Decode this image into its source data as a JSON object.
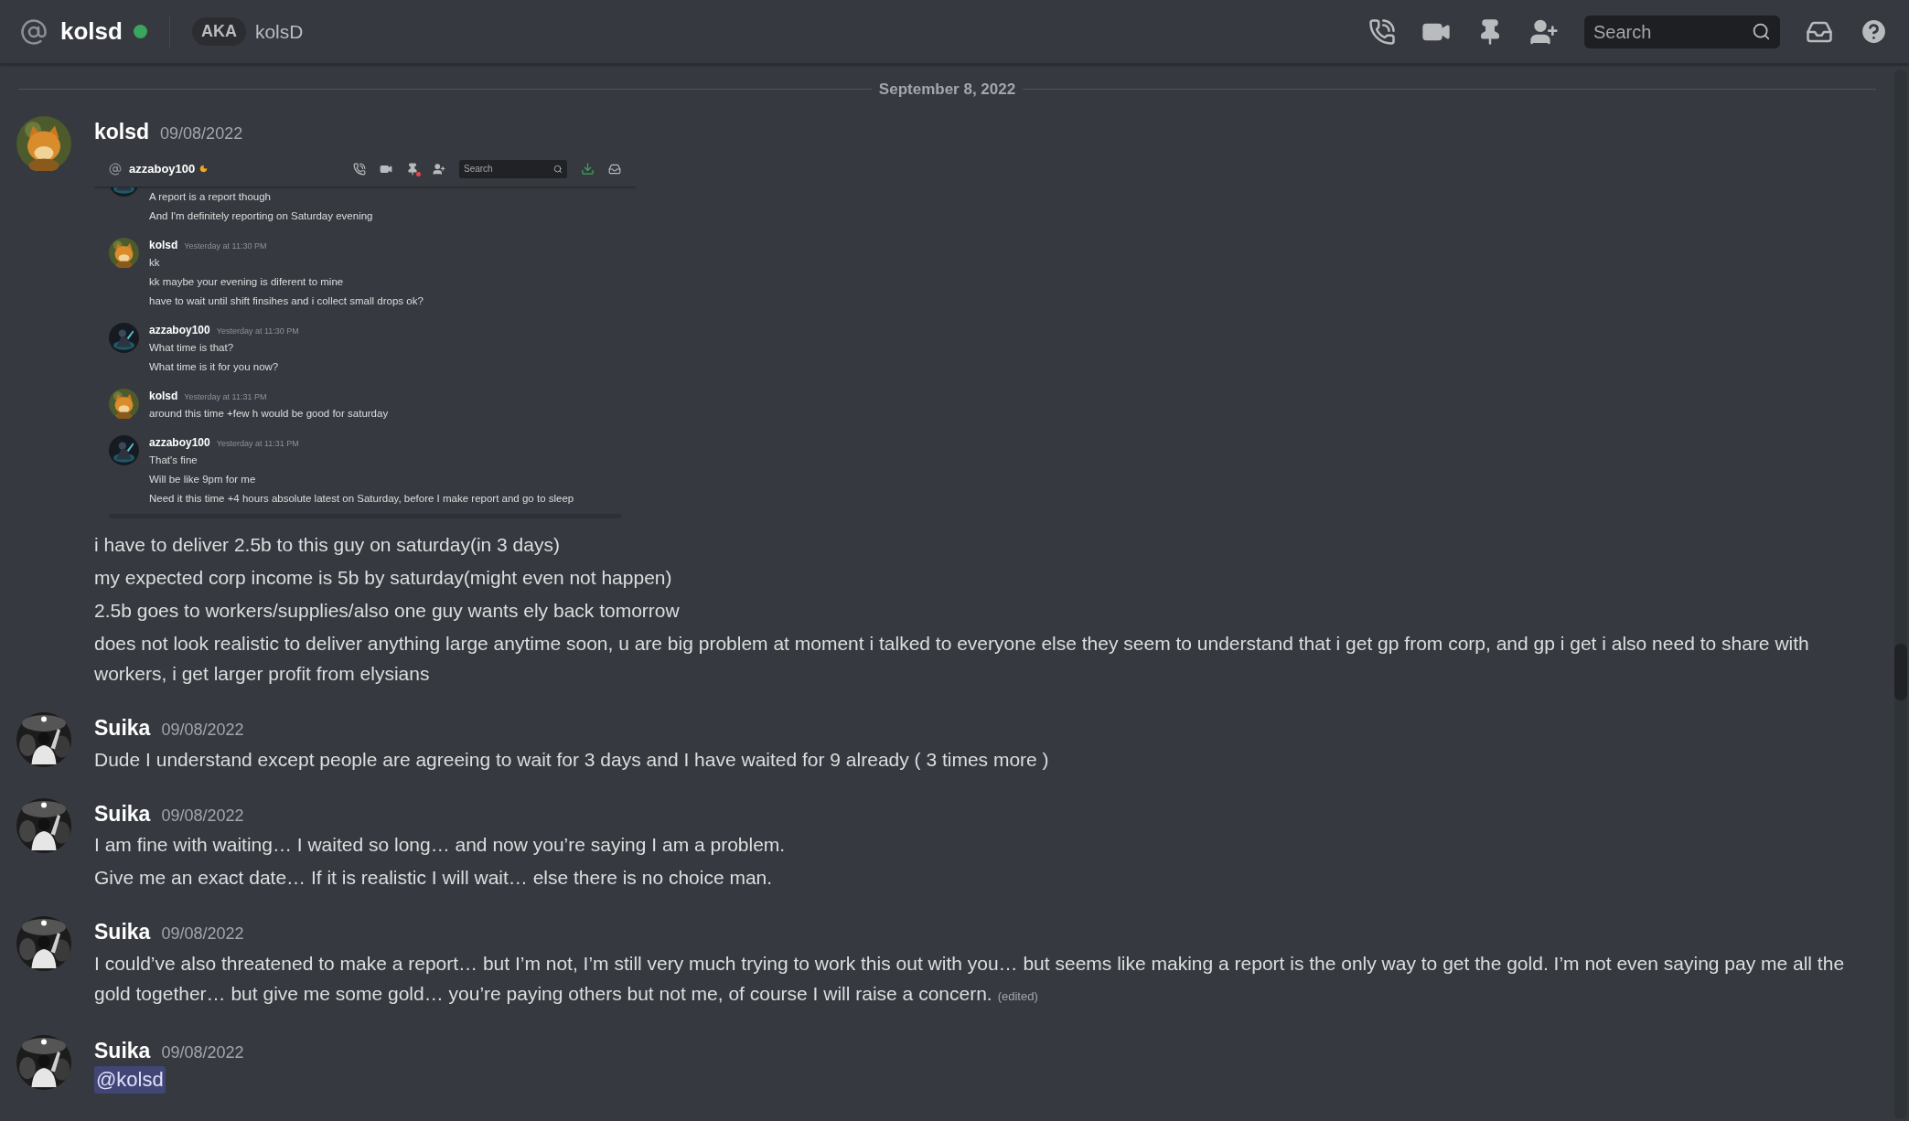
{
  "header": {
    "title": "kolsd",
    "online": true,
    "aka_label": "AKA",
    "aka_name": "kolsD",
    "search": {
      "placeholder": "Search"
    }
  },
  "date_divider": "September 8, 2022",
  "messages": [
    {
      "author": "kolsd",
      "time": "09/08/2022",
      "attachment": {
        "kind": "screenshot",
        "header": {
          "title": "azzaboy100",
          "idle": true,
          "search": {
            "placeholder": "Search"
          }
        },
        "messages": [
          {
            "lines": [
              "A report is a report though",
              "And I'm definitely reporting on Saturday evening"
            ]
          },
          {
            "author": "kolsd",
            "time": "Yesterday at 11:30 PM",
            "lines": [
              "kk",
              "kk maybe your evening is diferent to mine",
              "have to wait until shift finsihes and i collect small drops ok?"
            ]
          },
          {
            "author": "azzaboy100",
            "time": "Yesterday at 11:30 PM",
            "lines": [
              "What time is that?",
              "What time is it for you now?"
            ]
          },
          {
            "author": "kolsd",
            "time": "Yesterday at 11:31 PM",
            "lines": [
              "around this time +few h would be good for saturday"
            ]
          },
          {
            "author": "azzaboy100",
            "time": "Yesterday at 11:31 PM",
            "lines": [
              "That's fine",
              "Will be like 9pm for me",
              "Need it this time +4 hours absolute latest on Saturday, before I make report and go to sleep"
            ]
          }
        ]
      },
      "lines": [
        {
          "kind": "text",
          "text": "i have to deliver 2.5b to this guy on saturday(in 3 days)"
        },
        {
          "kind": "text",
          "text": "my expected corp income is 5b by saturday(might even not happen)"
        },
        {
          "kind": "text",
          "text": "2.5b goes to workers/supplies/also one guy wants ely back tomorrow"
        },
        {
          "kind": "text",
          "text": "does not look realistic to deliver anything large anytime soon, u are big problem at moment i talked to everyone else they seem to understand that i get gp from corp, and gp i get i also need to share with workers, i get larger profit from elysians"
        }
      ]
    },
    {
      "author": "Suika",
      "time": "09/08/2022",
      "lines": [
        {
          "kind": "text",
          "text": "Dude I understand except people are agreeing to wait for 3 days and I have waited for 9 already ( 3 times more )"
        }
      ]
    },
    {
      "author": "Suika",
      "time": "09/08/2022",
      "lines": [
        {
          "kind": "text",
          "text": "I am fine with waiting… I waited so long… and now you’re saying I am a problem."
        },
        {
          "kind": "text",
          "text": "Give me an exact date… If it is realistic I will wait… else there is no choice man."
        }
      ]
    },
    {
      "author": "Suika",
      "time": "09/08/2022",
      "lines": [
        {
          "kind": "text",
          "text": "I could’ve also threatened to make a report… but I’m not, I’m still very much trying to work this out with you… but seems like making a report is the only way to get the gold. I’m not even saying pay me all the gold together… but give me some gold… you’re paying others but not me, of course I will raise a concern.",
          "edited": "(edited)"
        }
      ]
    },
    {
      "author": "Suika",
      "time": "09/08/2022",
      "lines": [
        {
          "kind": "mention",
          "text": "@kolsd"
        }
      ]
    }
  ]
}
